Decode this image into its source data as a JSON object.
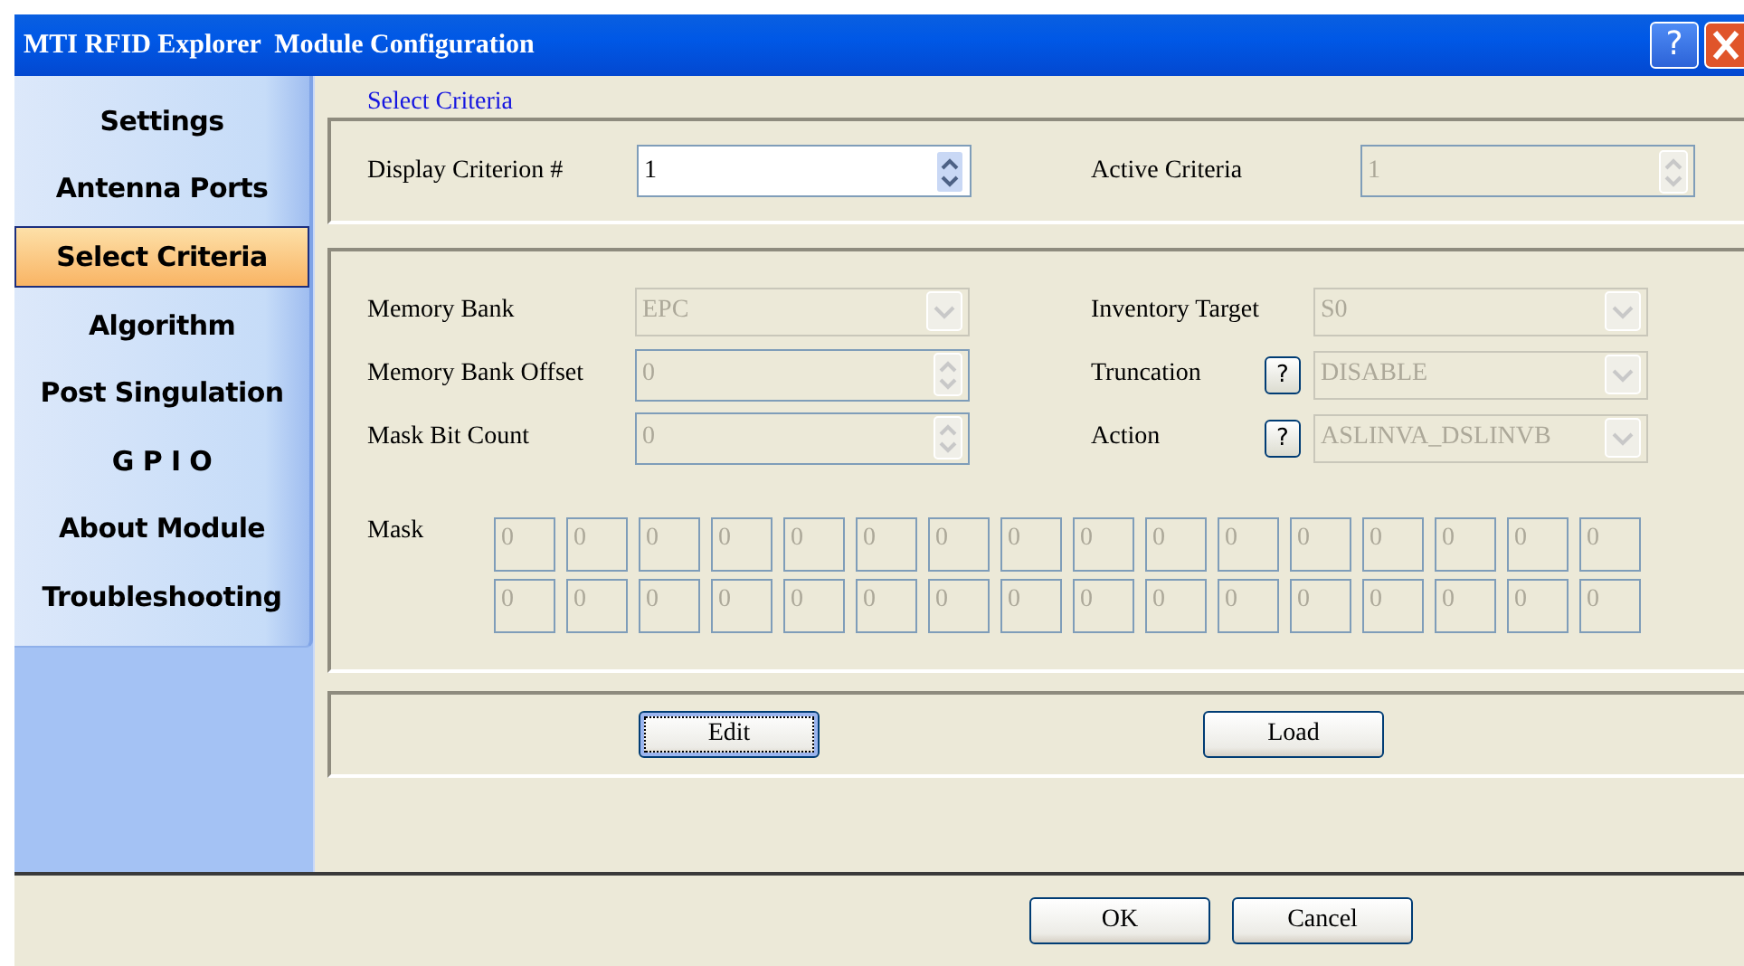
{
  "window": {
    "title": "MTI RFID Explorer  Module Configuration",
    "help_button": "?"
  },
  "sidebar": {
    "items": [
      {
        "label": "Settings",
        "selected": false
      },
      {
        "label": "Antenna Ports",
        "selected": false
      },
      {
        "label": "Select Criteria",
        "selected": true
      },
      {
        "label": "Algorithm",
        "selected": false
      },
      {
        "label": "Post Singulation",
        "selected": false
      },
      {
        "label": "G P I O",
        "selected": false
      },
      {
        "label": "About Module",
        "selected": false
      },
      {
        "label": "Troubleshooting",
        "selected": false
      }
    ]
  },
  "section_title": "Select Criteria",
  "criterion_fields": [
    {
      "label": "Display Criterion #",
      "kind": "spin",
      "value": "1",
      "disabled": false
    },
    {
      "label": "Active Criteria",
      "kind": "spin",
      "value": "1",
      "disabled": true
    }
  ],
  "left_fields": [
    {
      "label": "Memory Bank",
      "kind": "combo",
      "value": "EPC",
      "disabled": true
    },
    {
      "label": "Memory Bank Offset",
      "kind": "spin",
      "value": "0",
      "disabled": true
    },
    {
      "label": "Mask Bit Count",
      "kind": "spin",
      "value": "0",
      "disabled": true
    }
  ],
  "right_fields": [
    {
      "label": "Inventory Target",
      "kind": "combo",
      "value": "S0",
      "disabled": true
    },
    {
      "label": "Truncation",
      "kind": "combo",
      "value": "DISABLE",
      "disabled": true,
      "help": "?"
    },
    {
      "label": "Action",
      "kind": "combo",
      "value": "ASLINVA_DSLINVB",
      "disabled": true,
      "help": "?"
    }
  ],
  "mask": {
    "label": "Mask",
    "disabled": true,
    "rows": [
      [
        "0",
        "0",
        "0",
        "0",
        "0",
        "0",
        "0",
        "0",
        "0",
        "0",
        "0",
        "0",
        "0",
        "0",
        "0",
        "0"
      ],
      [
        "0",
        "0",
        "0",
        "0",
        "0",
        "0",
        "0",
        "0",
        "0",
        "0",
        "0",
        "0",
        "0",
        "0",
        "0",
        "0"
      ]
    ]
  },
  "actions": [
    {
      "label": "Edit",
      "focused": true
    },
    {
      "label": "Load",
      "focused": false
    }
  ],
  "footer_buttons": [
    {
      "label": "OK"
    },
    {
      "label": "Cancel"
    }
  ]
}
